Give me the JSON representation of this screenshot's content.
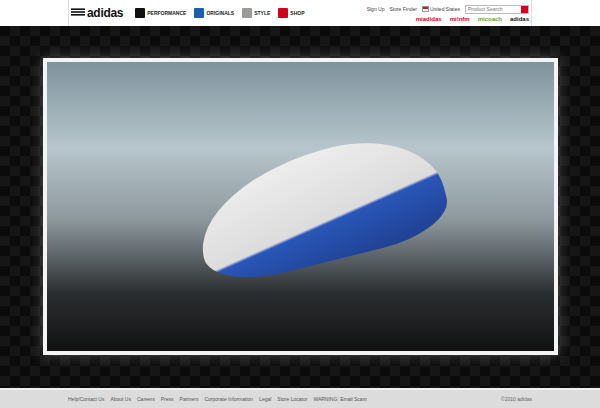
{
  "header": {
    "logo": "adidas",
    "nav": [
      {
        "label": "PERFORMANCE",
        "color": "#111111"
      },
      {
        "label": "ORIGINALS",
        "color": "#1a5fb4"
      },
      {
        "label": "STYLE",
        "color": "#9a9a9a"
      },
      {
        "label": "SHOP",
        "color": "#d0021b"
      }
    ],
    "utility_links": [
      "Sign Up",
      "Store Finder",
      "United States"
    ],
    "search": {
      "placeholder": "Product Search"
    },
    "sub_brands": [
      {
        "label": "miadidas",
        "color": "#d0021b"
      },
      {
        "label": "mi!nfm",
        "color": "#d0021b"
      },
      {
        "label": "micoach",
        "color": "#6aa51e"
      },
      {
        "label": "adidas",
        "color": "#111111"
      }
    ]
  },
  "footer": {
    "links": [
      "Help/Contact Us",
      "About Us",
      "Careers",
      "Press",
      "Partners",
      "Corporate Information",
      "Legal",
      "Store Locator",
      "WARNING: Email Scam"
    ],
    "copyright": "©2010 adidas"
  }
}
